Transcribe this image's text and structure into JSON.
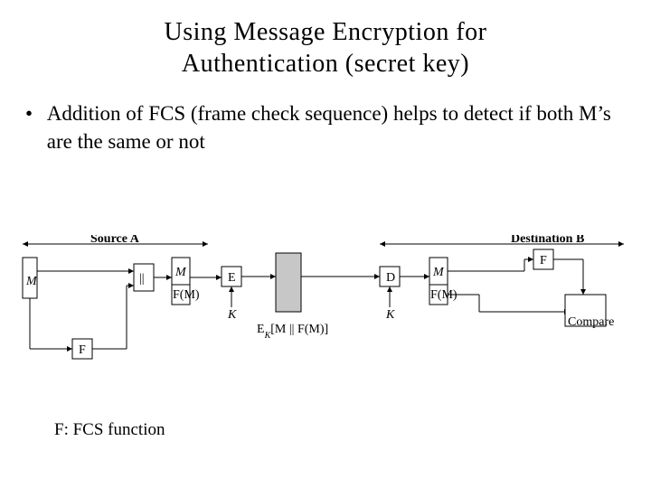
{
  "title_line1": "Using Message Encryption for",
  "title_line2": "Authentication (secret key)",
  "bullet": "Addition of FCS (frame check sequence) helps to detect if both M’s are the same or not",
  "diagram": {
    "source_label": "Source A",
    "dest_label": "Destination B",
    "M": "M",
    "FM": "F(M)",
    "E": "E",
    "D": "D",
    "F": "F",
    "K": "K",
    "concat": "||",
    "cipher": "E",
    "cipher_sub_prefix": "K",
    "cipher_body": "[M || F(M)]",
    "compare": "Compare"
  },
  "footer": "F: FCS function"
}
